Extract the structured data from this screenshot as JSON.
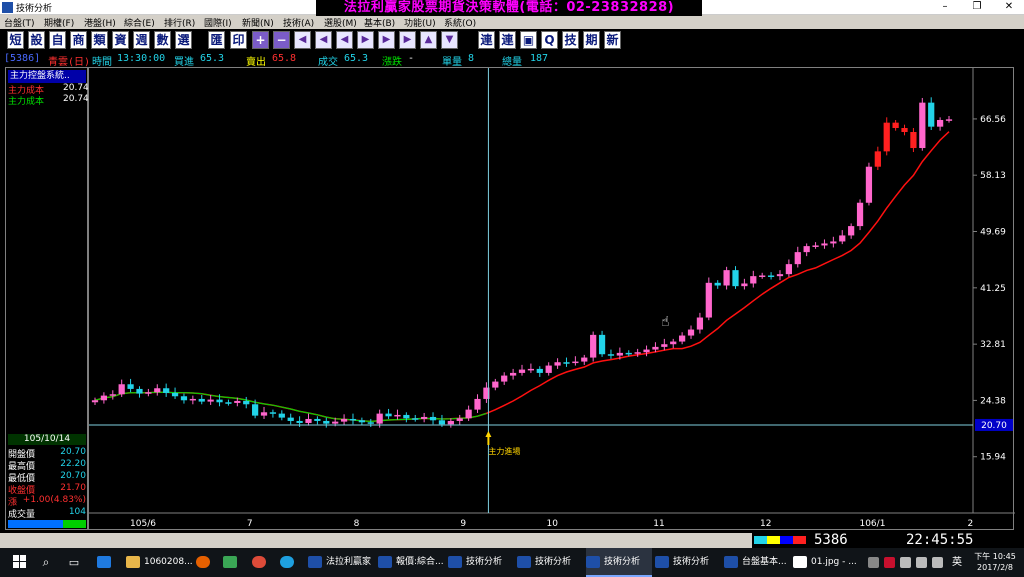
{
  "window": {
    "app_title": "技術分析",
    "minimize": "–",
    "restore": "❐",
    "close": "✕"
  },
  "banner": "法拉利贏家股票期貨決策軟體(電話：02-23832828)",
  "menu": [
    "台盤(T)",
    "期權(F)",
    "港盤(H)",
    "綜合(E)",
    "排行(R)",
    "國際(I)",
    "新聞(N)",
    "技術(A)",
    "選股(M)",
    "基本(B)",
    "功能(U)",
    "系統(O)"
  ],
  "toolbar": [
    "短",
    "設",
    "自",
    "商",
    "類",
    "資",
    "週",
    "數",
    "選",
    "匯",
    "印",
    "+",
    "−",
    "◀",
    "◀",
    "◀",
    "▶",
    "▶",
    "▶",
    "▲",
    "▼",
    "連",
    "連",
    "▣",
    "Q",
    "技",
    "期",
    "新"
  ],
  "info_bar": {
    "code": "[5386]",
    "name": "青雲(日)",
    "time_label": "時間",
    "time": "13:30:00",
    "bid_label": "買進",
    "bid": "65.3",
    "ask_label": "賣出",
    "ask": "65.8",
    "deal_label": "成交",
    "deal": "65.3",
    "change_label": "漲跌",
    "change": "-",
    "unit_vol_label": "單量",
    "unit_vol": "8",
    "total_vol_label": "總量",
    "total_vol": "187"
  },
  "left_panel": {
    "title": "主力控盤系統..",
    "cost_rows": [
      {
        "label": "主力成本",
        "value": "20.74",
        "color": "#ff3030"
      },
      {
        "label": "主力成本",
        "value": "20.74",
        "color": "#00e000"
      }
    ],
    "date": "105/10/14",
    "ohlc": [
      {
        "label": "開盤價",
        "value": "20.70",
        "color": "#ffffff"
      },
      {
        "label": "最高價",
        "value": "22.20",
        "color": "#ffffff"
      },
      {
        "label": "最低價",
        "value": "20.70",
        "color": "#ffffff"
      },
      {
        "label": "收盤價",
        "value": "21.70",
        "color": "#ff3030"
      },
      {
        "label": "漲",
        "value": "+1.00(4.83%)",
        "color": "#ff3030"
      },
      {
        "label": "成交量",
        "value": "104",
        "color": "#ffffff"
      }
    ]
  },
  "chart_data": {
    "type": "candlestick",
    "y_ticks": [
      "66.56",
      "58.13",
      "49.69",
      "41.25",
      "32.81",
      "24.38",
      "15.94"
    ],
    "x_labels": [
      "105/6",
      "7",
      "8",
      "9",
      "10",
      "11",
      "12",
      "106/1",
      "2"
    ],
    "cursor_value": "20.70",
    "entry_label": "主力進場",
    "colors": {
      "up": "#ff66cc",
      "down": "#22d3e8",
      "bigup": "#ff2020",
      "ma_red": "#ff1010",
      "ma_green": "#00d000"
    },
    "closes": [
      24.4,
      25.1,
      25.3,
      26.8,
      26.1,
      25.4,
      25.6,
      26.2,
      25.5,
      25.0,
      24.4,
      24.6,
      24.2,
      24.5,
      24.1,
      24.0,
      24.3,
      23.8,
      22.1,
      22.6,
      22.4,
      21.8,
      21.3,
      21.0,
      21.6,
      21.3,
      20.9,
      21.2,
      21.6,
      21.4,
      21.1,
      20.9,
      22.4,
      22.0,
      22.2,
      21.7,
      21.6,
      21.9,
      21.4,
      20.8,
      21.3,
      21.7,
      23.0,
      24.6,
      26.3,
      27.2,
      28.1,
      28.5,
      29.0,
      29.1,
      28.5,
      29.6,
      30.1,
      30.0,
      30.2,
      30.8,
      34.2,
      31.3,
      31.1,
      31.5,
      31.4,
      31.6,
      32.0,
      32.4,
      32.8,
      33.2,
      34.1,
      35.0,
      36.8,
      42.0,
      41.6,
      43.9,
      41.5,
      41.9,
      43.0,
      43.1,
      43.0,
      43.3,
      44.8,
      46.6,
      47.5,
      47.6,
      47.9,
      48.2,
      49.1,
      50.5,
      54.0,
      59.4,
      61.7,
      66.0,
      65.2,
      64.6,
      62.2,
      69.0,
      65.4,
      66.4,
      66.5
    ]
  },
  "status": {
    "code": "5386",
    "time": "22:45:55"
  },
  "taskbar": {
    "items": [
      "1060208...",
      "法拉利贏家",
      "報價:綜合...",
      "技術分析",
      "技術分析",
      "技術分析",
      "技術分析",
      "台盤基本...",
      "01.jpg - ..."
    ],
    "ime": "英",
    "clock_time": "下午 10:45",
    "clock_date": "2017/2/8"
  }
}
